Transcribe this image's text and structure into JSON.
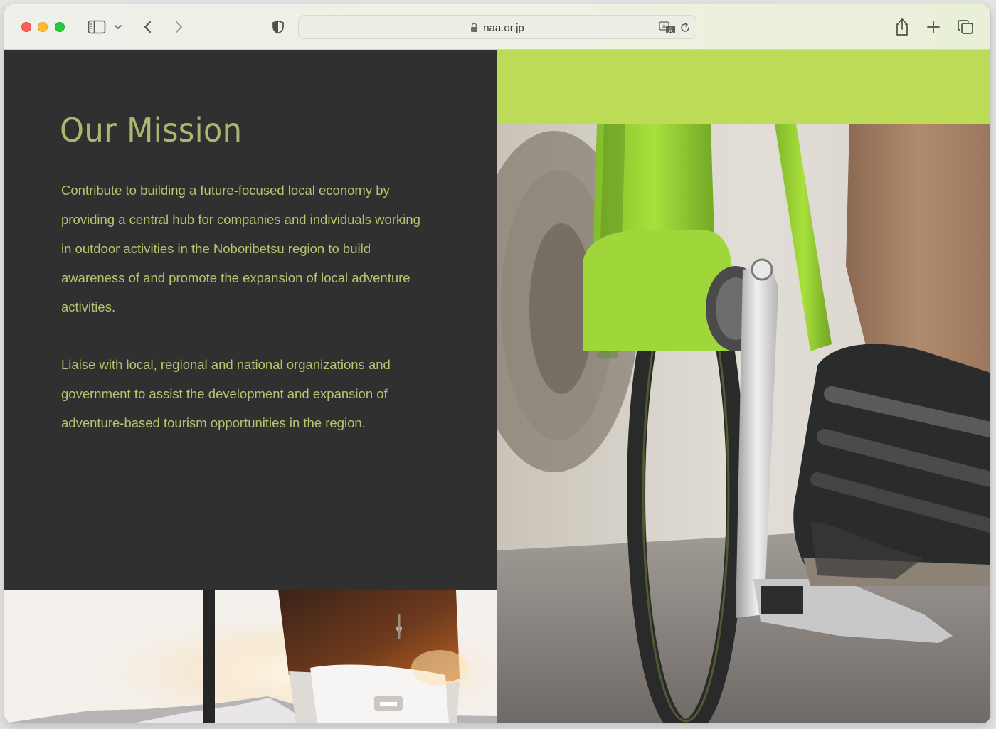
{
  "browser": {
    "url": "naa.or.jp"
  },
  "mission": {
    "title": "Our Mission",
    "paragraph_1": "Contribute to building a future-focused local economy by providing a central hub for companies and individuals working in outdoor activities in the Noboribetsu region to build awareness of and promote the expansion of local adventure activities.",
    "paragraph_2": "Liaise with local, regional and national organizations and government to assist the development and expansion of adventure-based tourism opportunities in the region."
  },
  "images": {
    "right_photo": "cyclist-pedaling-green-road-bike-photo",
    "bottom_photo": "hiker-with-trekking-pole-at-sunset-photo"
  },
  "colors": {
    "panel_background": "#303030",
    "heading_text": "#a8b870",
    "body_text": "#b8c46e",
    "accent_green": "#bcdb56"
  }
}
